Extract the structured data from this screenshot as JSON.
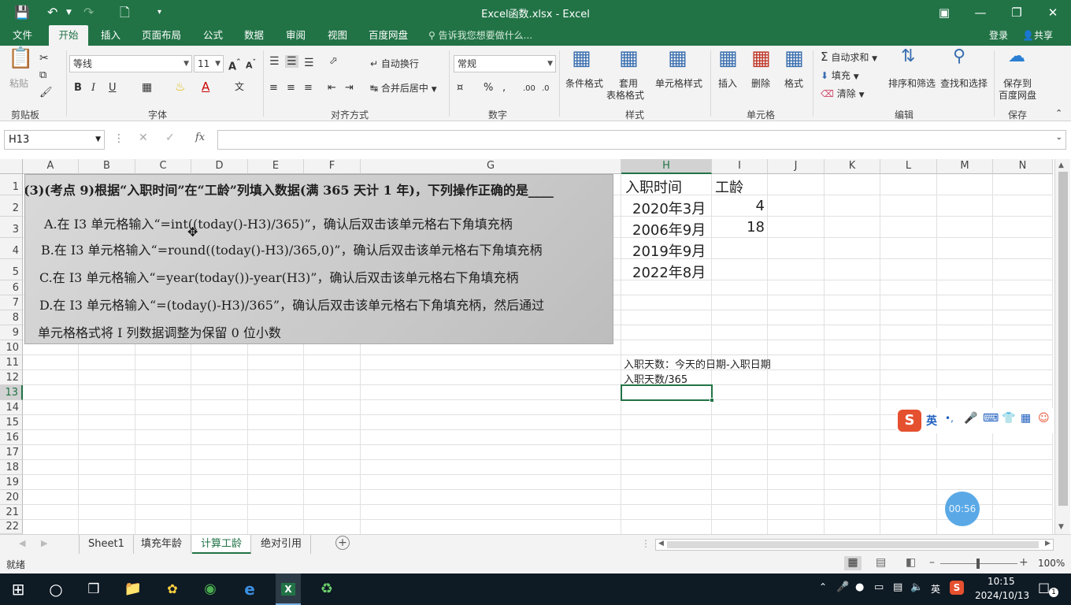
{
  "window": {
    "title": "Excel函数.xlsx - Excel"
  },
  "tabs": [
    {
      "label": "文件"
    },
    {
      "label": "开始"
    },
    {
      "label": "插入"
    },
    {
      "label": "页面布局"
    },
    {
      "label": "公式"
    },
    {
      "label": "数据"
    },
    {
      "label": "审阅"
    },
    {
      "label": "视图"
    },
    {
      "label": "百度网盘"
    }
  ],
  "tell_me": "告诉我您想要做什么...",
  "account": {
    "login": "登录",
    "share": "共享"
  },
  "ribbon": {
    "paste": "粘贴",
    "font_name": "等线",
    "font_size": "11",
    "wrap_text": "自动换行",
    "merge_center": "合并后居中",
    "number_format": "常规",
    "cond_format": "条件格式",
    "table_format_1": "套用",
    "table_format_2": "表格格式",
    "cell_style": "单元格样式",
    "insert": "插入",
    "delete": "删除",
    "format": "格式",
    "autosum": "自动求和",
    "fill": "填充",
    "clear": "清除",
    "sort_filter": "排序和筛选",
    "find_select": "查找和选择",
    "save_to_1": "保存到",
    "save_to_2": "百度网盘",
    "groups": [
      "剪贴板",
      "字体",
      "对齐方式",
      "数字",
      "样式",
      "单元格",
      "编辑",
      "保存"
    ]
  },
  "formula_bar": {
    "name_box": "H13",
    "fx": "fx",
    "formula": ""
  },
  "columns": [
    "A",
    "B",
    "C",
    "D",
    "E",
    "F",
    "G",
    "H",
    "I",
    "J",
    "K",
    "L",
    "M",
    "N"
  ],
  "rows": [
    "1",
    "2",
    "3",
    "4",
    "5",
    "6",
    "7",
    "8",
    "9",
    "10",
    "11",
    "12",
    "13",
    "14",
    "15",
    "16",
    "17",
    "18",
    "19",
    "20",
    "21",
    "22"
  ],
  "cells": {
    "H1": "入职时间",
    "I1": "工龄",
    "H2": "2020年3月",
    "I2": "4",
    "H3": "2006年9月",
    "I3": "18",
    "H4": "2019年9月",
    "H5": "2022年8月",
    "H11": "入职天数：今天的日期-入职日期",
    "H12": "入职天数/365"
  },
  "photo_lines": [
    "(3)(考点 9)根据“入职时间”在“工龄”列填入数据(满 365 天计 1 年)，下列操作正确的是____",
    "A.在 I3 单元格输入“=int((today()-H3)/365)”，确认后双击该单元格右下角填充柄",
    "B.在 I3 单元格输入“=round((today()-H3)/365,0)”，确认后双击该单元格右下角填充柄",
    "C.在 I3 单元格输入“=year(today())-year(H3)”，确认后双击该单元格右下角填充柄",
    "D.在 I3 单元格输入“=(today()-H3)/365”，确认后双击该单元格右下角填充柄，然后通过",
    "单元格格式将 I 列数据调整为保留 0 位小数"
  ],
  "sheets": [
    {
      "label": "Sheet1"
    },
    {
      "label": "填充年龄"
    },
    {
      "label": "计算工龄"
    },
    {
      "label": "绝对引用"
    }
  ],
  "status": {
    "ready": "就绪",
    "zoom": "100%"
  },
  "ime": {
    "lang": "英"
  },
  "timer": "00:56",
  "taskbar": {
    "time": "10:15",
    "date": "2024/10/13",
    "lang": "英",
    "notif_count": "1"
  },
  "colors": {
    "excel_green": "#217346",
    "taskbar": "#0e1a24"
  }
}
